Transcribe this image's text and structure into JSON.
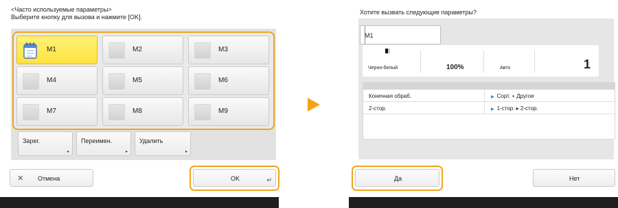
{
  "left": {
    "instruction_line1": "<Часто используемые параметры>",
    "instruction_line2": "Выберите кнопку для вызова и нажмите [OK].",
    "memory_buttons": [
      "M1",
      "M2",
      "M3",
      "M4",
      "M5",
      "M6",
      "M7",
      "M8",
      "M9"
    ],
    "selected": "M1",
    "actions": {
      "register": "Зарег.",
      "rename": "Переимен.",
      "delete": "Удалить"
    },
    "cancel_label": "Отмена",
    "ok_label": "OK"
  },
  "right": {
    "title": "Хотите вызвать следующие параметры?",
    "tab_label": "M1",
    "color_mode": "Черно-белый",
    "zoom": "100%",
    "paper": "Авто",
    "copies": "1",
    "settings": [
      {
        "key": "Конечная обраб.",
        "value": "Сорт. + Другое"
      },
      {
        "key": "2-стор.",
        "value": "1-стор. ▸ 2-стор."
      }
    ],
    "yes_label": "Да",
    "no_label": "Нет"
  },
  "colors": {
    "accent": "#f0a418",
    "selected_fill": "#ffe23c",
    "link_blue": "#3a7bd5"
  },
  "icons": {
    "memo": "notepad-icon",
    "cancel": "close-icon",
    "enter": "enter-arrow-icon",
    "next": "play-arrow-icon",
    "color": "bw-square-icon",
    "bullet": "triangle-bullet-icon"
  }
}
